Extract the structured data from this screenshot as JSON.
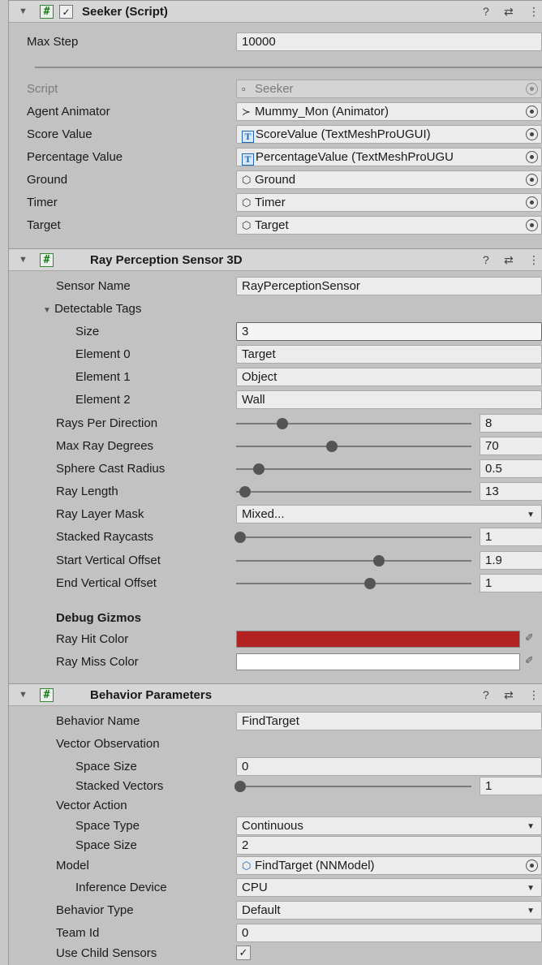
{
  "seeker": {
    "title": "Seeker (Script)",
    "max_step": {
      "label": "Max Step",
      "value": "10000"
    },
    "script": {
      "label": "Script",
      "value": "Seeker"
    },
    "agent_animator": {
      "label": "Agent Animator",
      "value": "Mummy_Mon (Animator)"
    },
    "score_value": {
      "label": "Score Value",
      "value": "ScoreValue (TextMeshProUGUI)"
    },
    "percentage_value": {
      "label": "Percentage Value",
      "value": "PercentageValue (TextMeshProUGU"
    },
    "ground": {
      "label": "Ground",
      "value": "Ground"
    },
    "timer": {
      "label": "Timer",
      "value": "Timer"
    },
    "target": {
      "label": "Target",
      "value": "Target"
    }
  },
  "ray": {
    "title": "Ray Perception Sensor 3D",
    "sensor_name": {
      "label": "Sensor Name",
      "value": "RayPerceptionSensor"
    },
    "detectable_tags": {
      "label": "Detectable Tags"
    },
    "size": {
      "label": "Size",
      "value": "3"
    },
    "elements": [
      {
        "label": "Element 0",
        "value": "Target"
      },
      {
        "label": "Element 1",
        "value": "Object"
      },
      {
        "label": "Element 2",
        "value": "Wall"
      }
    ],
    "sliders": [
      {
        "label": "Rays Per Direction",
        "value": "8",
        "level": 0.18
      },
      {
        "label": "Max Ray Degrees",
        "value": "70",
        "level": 0.39
      },
      {
        "label": "Sphere Cast Radius",
        "value": "0.5",
        "level": 0.08
      },
      {
        "label": "Ray Length",
        "value": "13",
        "level": 0.02
      }
    ],
    "ray_layer_mask": {
      "label": "Ray Layer Mask",
      "value": "Mixed..."
    },
    "sliders2": [
      {
        "label": "Stacked Raycasts",
        "value": "1",
        "level": 0.0
      },
      {
        "label": "Start Vertical Offset",
        "value": "1.9",
        "level": 0.59
      },
      {
        "label": "End Vertical Offset",
        "value": "1",
        "level": 0.55
      }
    ],
    "debug_gizmos": "Debug Gizmos",
    "ray_hit_color": {
      "label": "Ray Hit Color",
      "color": "#b22222"
    },
    "ray_miss_color": {
      "label": "Ray Miss Color",
      "color": "#ffffff"
    }
  },
  "behavior": {
    "title": "Behavior Parameters",
    "behavior_name": {
      "label": "Behavior Name",
      "value": "FindTarget"
    },
    "vector_observation": "Vector Observation",
    "obs_space_size": {
      "label": "Space Size",
      "value": "0"
    },
    "stacked_vectors": {
      "label": "Stacked Vectors",
      "value": "1",
      "level": 0.0
    },
    "vector_action": "Vector Action",
    "space_type": {
      "label": "Space Type",
      "value": "Continuous"
    },
    "act_space_size": {
      "label": "Space Size",
      "value": "2"
    },
    "model": {
      "label": "Model",
      "value": "FindTarget (NNModel)"
    },
    "inference_device": {
      "label": "Inference Device",
      "value": "CPU"
    },
    "behavior_type": {
      "label": "Behavior Type",
      "value": "Default"
    },
    "team_id": {
      "label": "Team Id",
      "value": "0"
    },
    "use_child_sensors": {
      "label": "Use Child Sensors",
      "checked": true
    }
  },
  "icons": {
    "check": "✓",
    "fold": "▼",
    "help": "❓",
    "preset": "⇄",
    "menu": "⋮",
    "prefab": "⬡",
    "anim": "⤚",
    "eyedropper": "✐"
  }
}
